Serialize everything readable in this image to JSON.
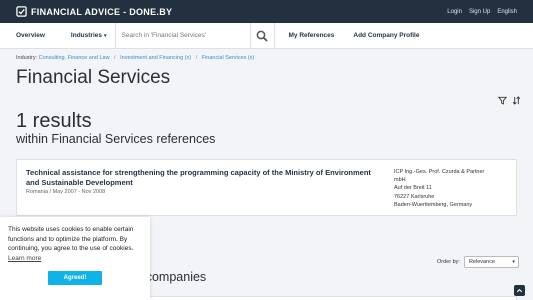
{
  "site": {
    "brand": "FINANCIAL ADVICE - DONE.BY",
    "top_links": [
      "Login",
      "Sign Up",
      "English"
    ]
  },
  "nav": {
    "overview": "Overview",
    "industries": "Industries",
    "search_placeholder": "Search in 'Financial Services'",
    "my_references": "My References",
    "add_company_profile": "Add Company Profile"
  },
  "breadcrumb": {
    "label": "Industry:",
    "items": [
      "Consulting, Finance and Law",
      "Investment and Financing (x)",
      "Financial Services (x)"
    ]
  },
  "page": {
    "title": "Financial Services",
    "results_count": "1 results",
    "results_sub": "within Financial Services references"
  },
  "result": {
    "title": "Technical assistance for strengthening the programming capacity of the Ministry of Environment and Sustainable Development",
    "meta": "Romania / May 2007 - Nov 2008",
    "address": [
      "ICP Ing.-Ges. Prof. Czurda & Partner",
      "mbH",
      "Auf der Breit 11",
      "76227 Karlsruhe",
      "Baden-Wuerttemberg, Germany"
    ]
  },
  "order": {
    "label": "Order by:",
    "value": "Relevance"
  },
  "companies_heading": "s companies",
  "cookie": {
    "text": "This website uses cookies to enable certain functions and to optimize the platform. By continuing, you agree to the use of cookies.",
    "learn_more": "Learn more",
    "accept": "Agreed!"
  },
  "icons": {
    "brand": "check-square-icon",
    "search": "search-icon",
    "filter": "filter-icon",
    "sort": "sort-icon",
    "scroll_top": "chevron-up-icon"
  },
  "colors": {
    "header_bg": "#23303f",
    "link": "#3a8dd0",
    "accept_button": "#10b3e8"
  }
}
